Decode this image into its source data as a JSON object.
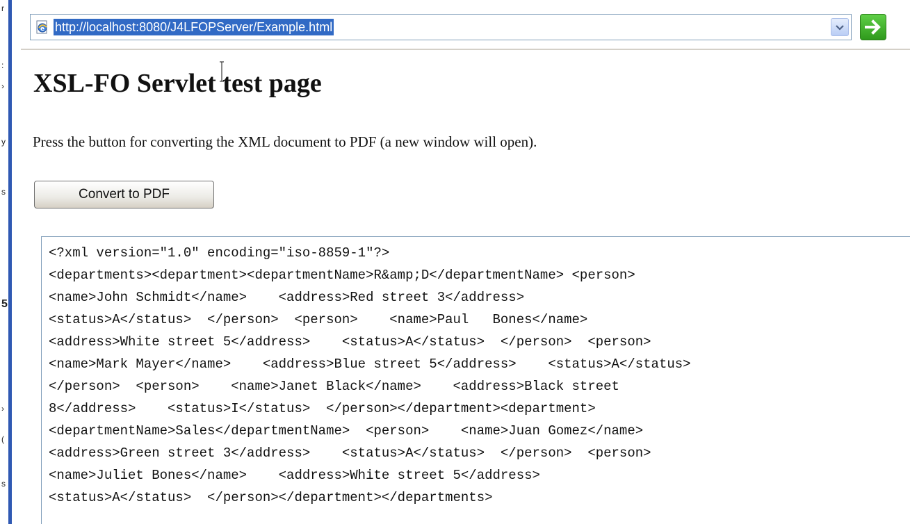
{
  "browser": {
    "address_url": "http://localhost:8080/J4LFOPServer/Example.html"
  },
  "left_edge_marks": [
    "r",
    ":",
    "›",
    "y",
    "s",
    "5",
    "›",
    "s",
    "("
  ],
  "page": {
    "title": "XSL-FO Servlet test page",
    "instructions": "Press the button for converting the XML document to PDF (a new window will open).",
    "convert_button_label": "Convert to PDF"
  },
  "xml_document": {
    "lines": [
      "<?xml version=\"1.0\" encoding=\"iso-8859-1\"?>",
      "<departments><department><departmentName>R&amp;D</departmentName> <person>",
      "<name>John Schmidt</name>    <address>Red street 3</address>",
      "<status>A</status>  </person>  <person>    <name>Paul   Bones</name>",
      "<address>White street 5</address>    <status>A</status>  </person>  <person>",
      "<name>Mark Mayer</name>    <address>Blue street 5</address>    <status>A</status>",
      "</person>  <person>    <name>Janet Black</name>    <address>Black street",
      "8</address>    <status>I</status>  </person></department><department>",
      "<departmentName>Sales</departmentName>  <person>    <name>Juan Gomez</name>",
      "<address>Green street 3</address>    <status>A</status>  </person>  <person>",
      "<name>Juliet Bones</name>    <address>White street 5</address>",
      "<status>A</status>  </person></department></departments>"
    ]
  },
  "colors": {
    "url_highlight": "#316ac5",
    "go_button": "#3aa82a",
    "left_bar": "#2f59b3"
  }
}
